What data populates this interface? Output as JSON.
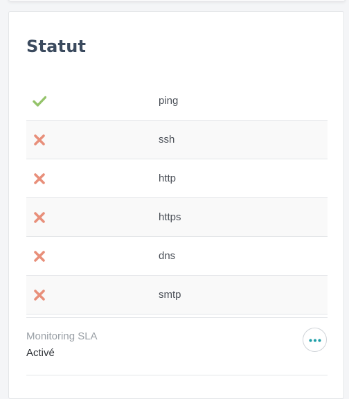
{
  "card": {
    "title": "Statut"
  },
  "status": {
    "rows": [
      {
        "label": "ping",
        "state": "ok",
        "icon": "check-icon"
      },
      {
        "label": "ssh",
        "state": "fail",
        "icon": "cross-icon"
      },
      {
        "label": "http",
        "state": "fail",
        "icon": "cross-icon"
      },
      {
        "label": "https",
        "state": "fail",
        "icon": "cross-icon"
      },
      {
        "label": "dns",
        "state": "fail",
        "icon": "cross-icon"
      },
      {
        "label": "smtp",
        "state": "fail",
        "icon": "cross-icon"
      }
    ]
  },
  "sla": {
    "label": "Monitoring SLA",
    "value": "Activé",
    "more_icon": "more-horizontal-icon"
  },
  "colors": {
    "ok": "#94c36a",
    "fail": "#e88f7a",
    "accent": "#1f9fa8",
    "title": "#3b4a5e"
  }
}
